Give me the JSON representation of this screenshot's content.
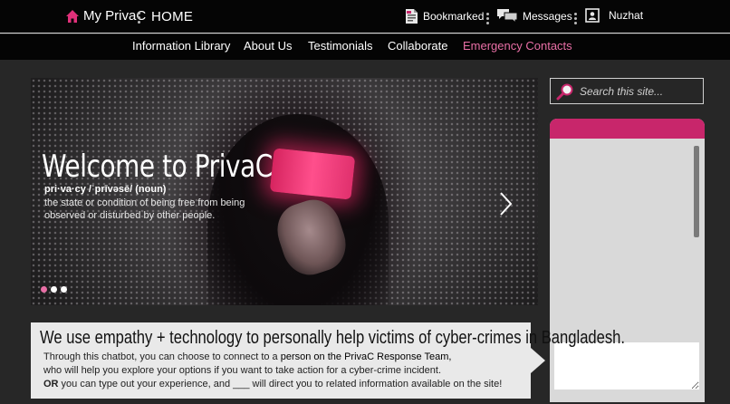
{
  "topbar": {
    "brand": "My PrivaC",
    "section": "HOME",
    "bookmarked": "Bookmarked",
    "messages": "Messages",
    "user": "Nuzhat"
  },
  "nav": {
    "items": [
      "Information Library",
      "About Us",
      "Testimonials",
      "Collaborate",
      "Emergency Contacts"
    ],
    "active_index": 4
  },
  "hero": {
    "title": "Welcome to PrivaC",
    "pronunciation": "pri·va·cy /ˈprīvəsē/ (noun)",
    "definition": "the state or condition of being free from being observed or disturbed by other people.",
    "slides_total": 3,
    "active_slide": 1
  },
  "search": {
    "placeholder": "Search this site..."
  },
  "callout": {
    "title": "We use empathy + technology to personally help victims of cyber-crimes in Bangladesh.",
    "line1_pre": "Through this chatbot, you can choose to connect to a ",
    "line1_strong": "person on the PrivaC Response Team,",
    "line2": "who will help you explore your options if you want to take action for a cyber-crime incident.",
    "line3_or": "OR",
    "line3_rest": " you can type out your experience, and ___ will direct you to related information available on the site!"
  },
  "colors": {
    "accent": "#c8266b",
    "accent_light": "#e96fa6",
    "bar": "#050505",
    "background": "#272727"
  },
  "icons": [
    "home-icon",
    "bookmark-icon",
    "messages-icon",
    "profile-icon",
    "search-icon",
    "next-arrow-icon"
  ]
}
